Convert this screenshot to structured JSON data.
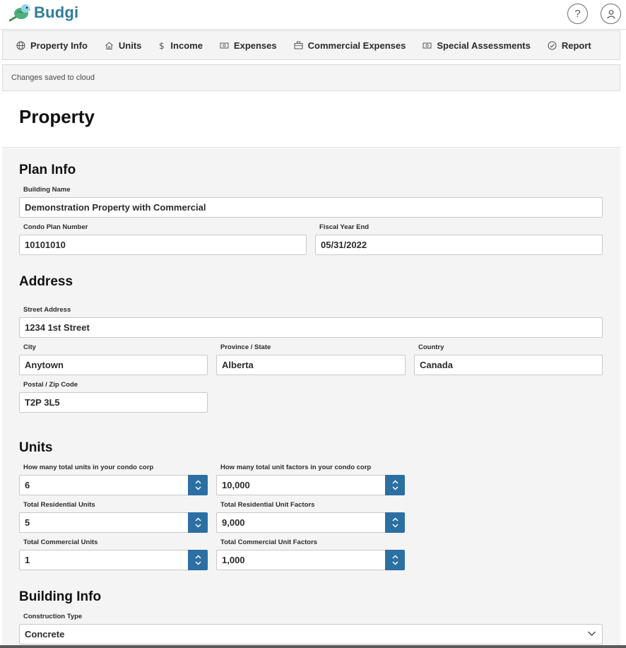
{
  "app": {
    "name": "Budgi"
  },
  "header": {
    "help_icon": "question-circle-icon",
    "account_icon": "user-circle-icon"
  },
  "nav": {
    "items": [
      {
        "label": "Property Info",
        "icon": "globe-icon"
      },
      {
        "label": "Units",
        "icon": "home-icon"
      },
      {
        "label": "Income",
        "icon": "dollar-icon"
      },
      {
        "label": "Expenses",
        "icon": "cash-icon"
      },
      {
        "label": "Commercial Expenses",
        "icon": "briefcase-icon"
      },
      {
        "label": "Special Assessments",
        "icon": "cash-icon"
      },
      {
        "label": "Report",
        "icon": "check-circle-icon"
      }
    ]
  },
  "status": {
    "text": "Changes saved to cloud"
  },
  "page": {
    "title": "Property"
  },
  "plan_info": {
    "title": "Plan Info",
    "building_name": {
      "label": "Building Name",
      "value": "Demonstration Property with Commercial"
    },
    "condo_plan_number": {
      "label": "Condo Plan Number",
      "value": "10101010"
    },
    "fiscal_year_end": {
      "label": "Fiscal Year End",
      "value": "05/31/2022"
    }
  },
  "address": {
    "title": "Address",
    "street": {
      "label": "Street Address",
      "value": "1234 1st Street"
    },
    "city": {
      "label": "City",
      "value": "Anytown"
    },
    "province": {
      "label": "Province / State",
      "value": "Alberta"
    },
    "country": {
      "label": "Country",
      "value": "Canada"
    },
    "postal": {
      "label": "Postal / Zip Code",
      "value": "T2P 3L5"
    }
  },
  "units": {
    "title": "Units",
    "total_units": {
      "label": "How many total units in your condo corp",
      "value": "6"
    },
    "total_unit_factors": {
      "label": "How many total unit factors in your condo corp",
      "value": "10,000"
    },
    "residential_units": {
      "label": "Total Residential Units",
      "value": "5"
    },
    "residential_unit_factors": {
      "label": "Total Residential Unit Factors",
      "value": "9,000"
    },
    "commercial_units": {
      "label": "Total Commercial Units",
      "value": "1"
    },
    "commercial_unit_factors": {
      "label": "Total Commercial Unit Factors",
      "value": "1,000"
    }
  },
  "building_info": {
    "title": "Building Info",
    "construction_type": {
      "label": "Construction Type",
      "value": "Concrete"
    }
  },
  "colors": {
    "brand": "#2f7d9a",
    "stepper": "#2b6fa3",
    "panel_bg": "#f4f4f4"
  }
}
